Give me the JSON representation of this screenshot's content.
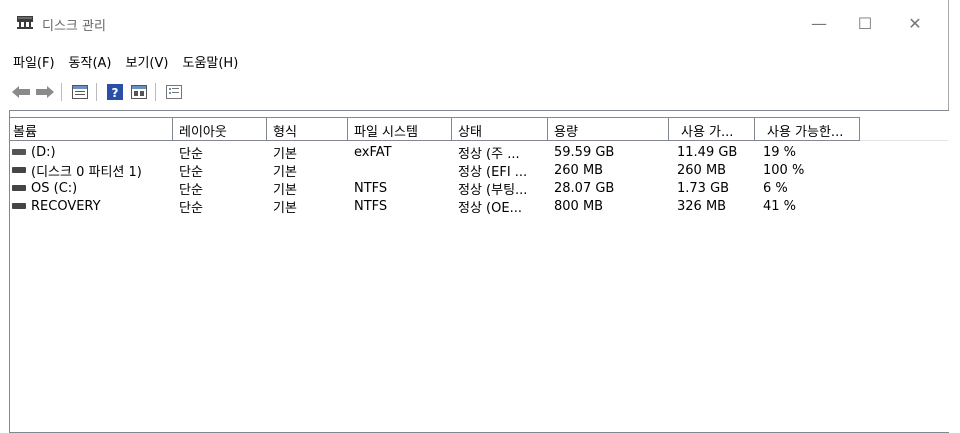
{
  "window": {
    "title": "디스크 관리",
    "controls": {
      "minimize": "—",
      "maximize": "☐",
      "close": "✕"
    }
  },
  "menu": [
    {
      "label": "파일(F)"
    },
    {
      "label": "동작(A)"
    },
    {
      "label": "보기(V)"
    },
    {
      "label": "도움말(H)"
    }
  ],
  "toolbar": {
    "icons": [
      "back-arrow-icon",
      "forward-arrow-icon",
      "disk-list-icon",
      "help-icon",
      "disk-graph-icon",
      "properties-icon"
    ]
  },
  "table": {
    "columns": [
      "볼륨",
      "레이아웃",
      "형식",
      "파일 시스템",
      "상태",
      "용량",
      "사용 가...",
      "사용 가능한..."
    ],
    "rows": [
      {
        "volume": " (D:)",
        "layout": "단순",
        "type": "기본",
        "fs": "exFAT",
        "status": "정상 (주 ...",
        "capacity": "59.59 GB",
        "free": "11.49 GB",
        "pct": "19 %"
      },
      {
        "volume": "(디스크 0 파티션 1)",
        "layout": "단순",
        "type": "기본",
        "fs": "",
        "status": "정상 (EFI ...",
        "capacity": "260 MB",
        "free": "260 MB",
        "pct": "100 %"
      },
      {
        "volume": "OS (C:)",
        "layout": "단순",
        "type": "기본",
        "fs": "NTFS",
        "status": "정상 (부팅...",
        "capacity": "28.07 GB",
        "free": "1.73 GB",
        "pct": "6 %"
      },
      {
        "volume": "RECOVERY",
        "layout": "단순",
        "type": "기본",
        "fs": "NTFS",
        "status": "정상 (OE...",
        "capacity": "800 MB",
        "free": "326 MB",
        "pct": "41 %"
      }
    ]
  }
}
